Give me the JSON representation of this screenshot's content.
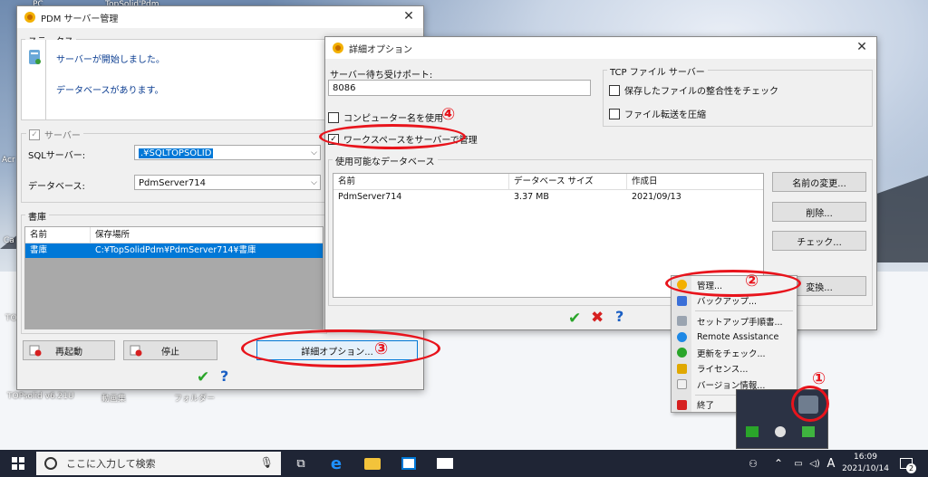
{
  "desktop": {
    "icons": [
      "PC",
      "TopSolid'Pdm",
      "Acr",
      "Ca",
      "TOPsolid v6.21U",
      "動画集",
      "フォルダー",
      "TO"
    ],
    "bg_colors": {
      "sky": "#7f96b3",
      "snow": "#f4f6f9"
    }
  },
  "pdm_window": {
    "title": "PDM サーバー管理",
    "status_group": "ステータス",
    "status_lines": [
      "サーバーが開始しました。",
      "データベースがあります。"
    ],
    "server_group": "サーバー",
    "sql_label": "SQLサーバー:",
    "sql_value": ".¥SQLTOPSOLID",
    "db_label": "データベース:",
    "db_value": "PdmServer714",
    "vault_group": "書庫",
    "vault_columns": [
      "名前",
      "保存場所"
    ],
    "vault_rows": [
      [
        "書庫",
        "C:¥TopSolidPdm¥PdmServer714¥書庫"
      ]
    ],
    "restart_btn": "再起動",
    "stop_btn": "停止",
    "advanced_btn": "詳細オプション..."
  },
  "advanced_window": {
    "title": "詳細オプション",
    "port_label": "サーバー待ち受けポート:",
    "port_value": "8086",
    "use_computer_name": "コンピューター名を使用",
    "manage_workspace": "ワークスペースをサーバーで管理",
    "tcp_group": "TCP ファイル サーバー",
    "check_integrity": "保存したファイルの整合性をチェック",
    "compress_transfer": "ファイル転送を圧縮",
    "db_group": "使用可能なデータベース",
    "db_columns": [
      "名前",
      "データベース サイズ",
      "作成日"
    ],
    "db_rows": [
      [
        "PdmServer714",
        "3.37 MB",
        "2021/09/13"
      ]
    ],
    "rename_btn": "名前の変更...",
    "delete_btn": "削除...",
    "check_btn": "チェック...",
    "convert_btn": "変換..."
  },
  "tray_menu": {
    "items": [
      "管理...",
      "バックアップ...",
      "セットアップ手順書...",
      "Remote Assistance",
      "更新をチェック...",
      "ライセンス...",
      "バージョン情報...",
      "終了"
    ]
  },
  "annotations": [
    "①",
    "②",
    "③",
    "④"
  ],
  "taskbar": {
    "search_placeholder": "ここに入力して検索",
    "ime": "A",
    "time": "16:09",
    "date": "2021/10/14",
    "notif_count": "2"
  },
  "colors": {
    "accent": "#0078d7",
    "annotation": "#e8141c",
    "ok_green": "#2aa52a",
    "cancel_red": "#d62020",
    "help_blue": "#1a5fc4"
  }
}
